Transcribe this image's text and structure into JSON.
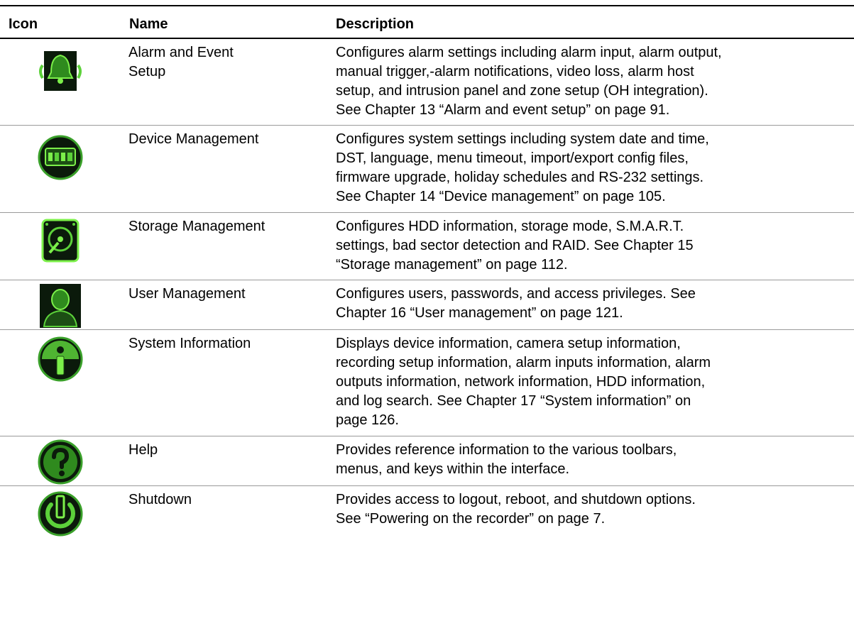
{
  "table": {
    "headers": {
      "icon": "Icon",
      "name": "Name",
      "description": "Description"
    },
    "rows": [
      {
        "icon": "alarm-bell-icon",
        "name_lines": [
          "Alarm and Event",
          "Setup"
        ],
        "desc_lines": [
          "Configures alarm settings including alarm input, alarm output,",
          "manual trigger,-alarm notifications, video loss, alarm host",
          "setup, and intrusion panel and zone setup (OH integration).",
          "See Chapter 13 “Alarm and event setup” on page 91."
        ]
      },
      {
        "icon": "device-management-icon",
        "name_lines": [
          "Device Management"
        ],
        "desc_lines": [
          "Configures system settings including system date and time,",
          "DST, language, menu timeout, import/export config files,",
          "firmware upgrade, holiday schedules and RS-232 settings.",
          "See Chapter 14 “Device management” on page 105."
        ]
      },
      {
        "icon": "hard-disk-icon",
        "name_lines": [
          "Storage Management"
        ],
        "desc_lines": [
          "Configures HDD information, storage mode, S.M.A.R.T.",
          "settings, bad sector detection and RAID. See Chapter 15",
          "“Storage management” on page 112."
        ]
      },
      {
        "icon": "user-icon",
        "name_lines": [
          "User Management"
        ],
        "desc_lines": [
          "Configures users, passwords, and access privileges. See",
          "Chapter 16 “User management” on page 121."
        ]
      },
      {
        "icon": "info-icon",
        "name_lines": [
          "System Information"
        ],
        "desc_lines": [
          "Displays device information, camera setup information,",
          "recording setup information, alarm inputs information, alarm",
          "outputs information, network information, HDD information,",
          "and log search. See Chapter 17 “System information” on",
          "page 126."
        ]
      },
      {
        "icon": "help-question-icon",
        "name_lines": [
          "Help"
        ],
        "desc_lines": [
          "Provides reference information to the various toolbars,",
          "menus, and keys within the interface."
        ]
      },
      {
        "icon": "power-icon",
        "name_lines": [
          "Shutdown"
        ],
        "desc_lines": [
          "Provides access to logout, reboot, and shutdown options.",
          "See “Powering on the recorder” on page 7."
        ]
      }
    ]
  },
  "colors": {
    "icon_green": "#5cd13a",
    "icon_dark": "#0b1a0b",
    "rule": "#9a9a9a"
  }
}
